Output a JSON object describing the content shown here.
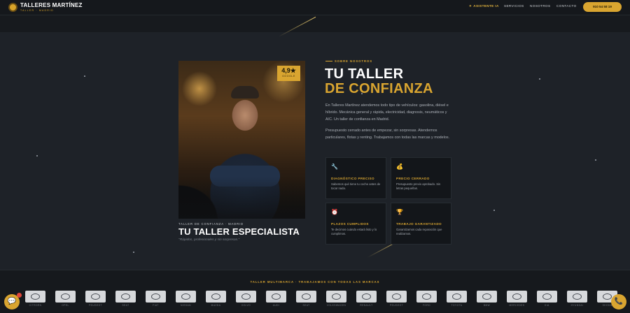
{
  "header": {
    "brand_title": "TALLERES MARTÍNEZ",
    "brand_subtitle": "TALLER · MADRID",
    "nav": {
      "asistente": "ASISTENTE IA",
      "servicios": "SERVICIOS",
      "nosotros": "NOSOTROS",
      "contacto": "CONTACTO"
    },
    "phone_label": "910 54 58 19"
  },
  "hero": {
    "rating_value": "4,9★",
    "rating_label": "GOOGLE",
    "kicker": "TALLER DE CONFIANZA · MADRID",
    "title": "TU TALLER ESPECIALISTA",
    "quote": "\"Rápidos, profesionales y sin sorpresas.\""
  },
  "about": {
    "kicker": "SOBRE NOSOTROS",
    "title_line1": "TU TALLER",
    "title_line2": "DE CONFIANZA",
    "paragraph1": "En Talleres Martínez atendemos todo tipo de vehículos: gasolina, diésel e híbrido. Mecánica general y rápida, electricidad, diagnosis, neumáticos y A/C. Un taller de confianza en Madrid.",
    "paragraph2": "Presupuesto cerrado antes de empezar, sin sorpresas. Atendemos particulares, flotas y renting. Trabajamos con todas las marcas y modelos."
  },
  "features": [
    {
      "icon": "🔧",
      "icon_name": "wrench-icon",
      "title": "DIAGNÓSTICO PRECISO",
      "text": "Sabemos qué tiene tu coche antes de tocar nada."
    },
    {
      "icon": "💰",
      "icon_name": "money-bag-icon",
      "title": "PRECIO CERRADO",
      "text": "Presupuesto previo aprobado. Sin letras pequeñas."
    },
    {
      "icon": "⏰",
      "icon_name": "alarm-clock-icon",
      "title": "PLAZOS CUMPLIDOS",
      "text": "Te decimos cuándo estará listo y lo cumplimos."
    },
    {
      "icon": "🏆",
      "icon_name": "trophy-icon",
      "title": "TRABAJO GARANTIZADO",
      "text": "Garantizamos cada reparación que realizamos."
    }
  ],
  "brands": {
    "kicker": "TALLER MULTIMARCA · TRABAJAMOS CON TODAS LAS MARCAS",
    "items": [
      "CITROËN",
      "OPEL",
      "PEUGEOT",
      "SEAT",
      "FIAT",
      "NISSAN",
      "MAZDA",
      "VOLVO",
      "AUDI",
      "SEAT",
      "VOLKSWAGEN",
      "RENAULT",
      "PEUGEOT",
      "FORD",
      "TOYOTA",
      "BMW",
      "MERCEDES",
      "KIA",
      "HYUNDAI",
      "SKODA"
    ]
  },
  "colors": {
    "accent": "#d9a530",
    "background": "#1e2228",
    "card": "#13161a"
  }
}
